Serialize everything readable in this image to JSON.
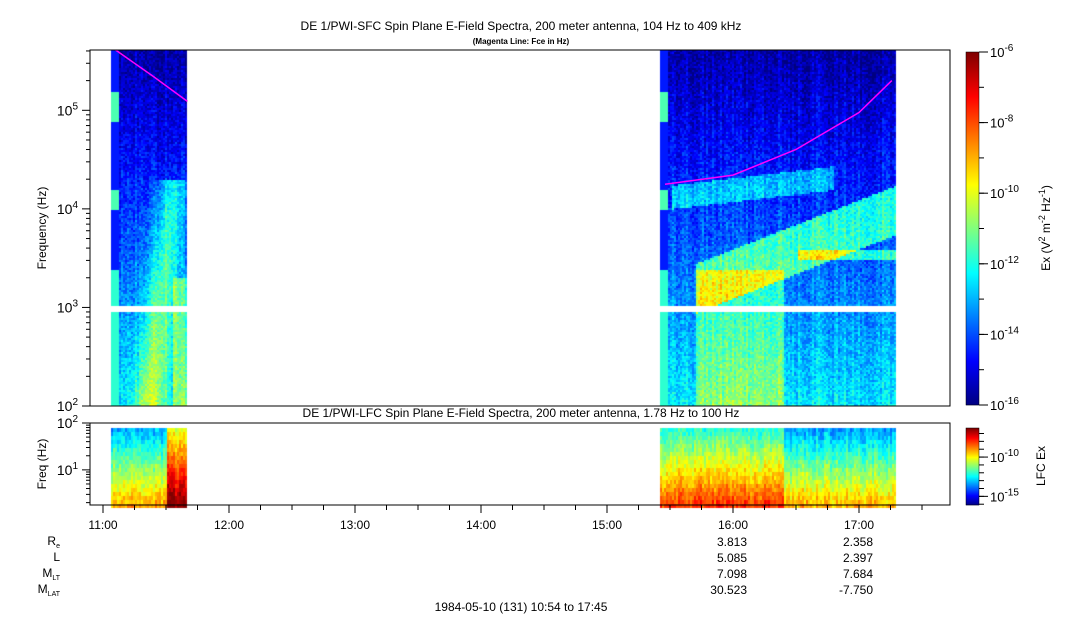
{
  "chart_data": [
    {
      "type": "heatmap",
      "title": "DE 1/PWI-SFC  Spin Plane E-Field Spectra, 200 meter antenna, 104 Hz to 409 kHz",
      "subtitle": "(Magenta Line: Fce in Hz)",
      "ylabel": "Frequency (Hz)",
      "yscale": "log",
      "ylim": [
        100,
        409000
      ],
      "ytick_exponents": [
        2,
        3,
        4,
        5
      ],
      "xlim_hours": [
        10.9,
        17.75
      ],
      "data_intervals_hours": [
        [
          11.06,
          11.67
        ],
        [
          15.42,
          17.29
        ]
      ],
      "colorbar": {
        "label": "Ex (V2 m-2 Hz-1)",
        "label_parts": [
          "Ex (V",
          "2",
          " m",
          "-2",
          " Hz",
          "-1",
          ")"
        ],
        "log_range": [
          -16,
          -6
        ],
        "tick_exponents": [
          "-6",
          "-8",
          "-10",
          "-12",
          "-14",
          "-16"
        ]
      },
      "fce_line": {
        "color": "#ff00ff",
        "segments": [
          [
            {
              "t": 11.1,
              "f": 409000
            },
            {
              "t": 11.4,
              "f": 220000
            },
            {
              "t": 11.67,
              "f": 123000
            }
          ],
          [
            {
              "t": 15.46,
              "f": 17800
            },
            {
              "t": 16.0,
              "f": 22000
            },
            {
              "t": 16.5,
              "f": 40000
            },
            {
              "t": 17.0,
              "f": 95000
            },
            {
              "t": 17.26,
              "f": 200000
            }
          ]
        ]
      }
    },
    {
      "type": "heatmap",
      "title": "DE 1/PWI-LFC  Spin Plane E-Field Spectra, 200 meter antenna, 1.78 Hz to 100 Hz",
      "ylabel": "Freq (Hz)",
      "yscale": "log",
      "ylim": [
        1.78,
        100
      ],
      "ytick_exponents": [
        1,
        2
      ],
      "colorbar": {
        "label": "LFC Ex",
        "log_range": [
          -16.1,
          -6.3
        ],
        "tick_exponents": [
          "-10",
          "-15"
        ]
      }
    }
  ],
  "xaxis": {
    "tick_labels": [
      "11:00",
      "12:00",
      "13:00",
      "14:00",
      "15:00",
      "16:00",
      "17:00"
    ],
    "tick_hours": [
      11,
      12,
      13,
      14,
      15,
      16,
      17
    ]
  },
  "ephemeris": {
    "labels": [
      {
        "main": "R",
        "sub": "e"
      },
      {
        "main": "L",
        "sub": ""
      },
      {
        "main": "M",
        "sub": "LT"
      },
      {
        "main": "M",
        "sub": "LAT"
      }
    ],
    "columns": [
      {
        "time": "16:00",
        "values": [
          "3.813",
          "5.085",
          "7.098",
          "30.523"
        ]
      },
      {
        "time": "17:00",
        "values": [
          "2.358",
          "2.397",
          "7.684",
          "-7.750"
        ]
      }
    ]
  },
  "footer": "1984-05-10 (131) 10:54 to 17:45"
}
